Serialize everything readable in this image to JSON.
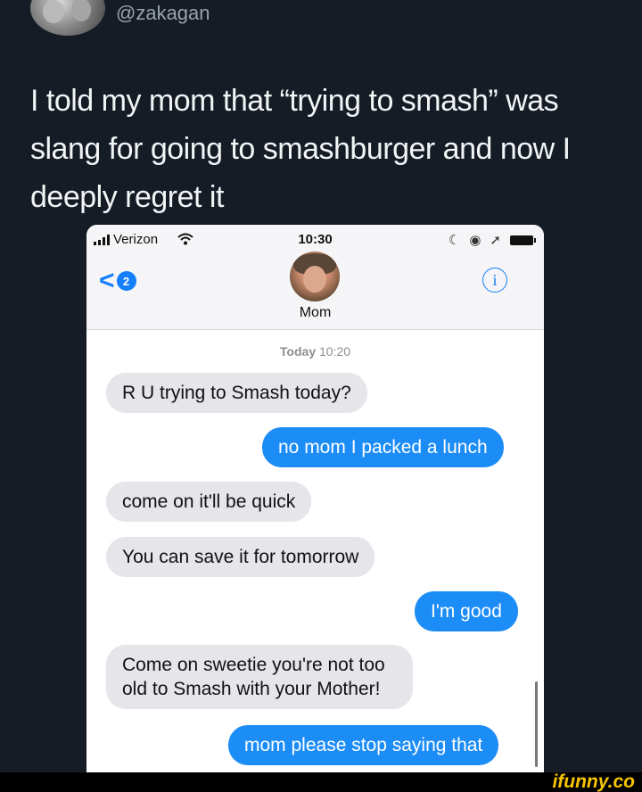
{
  "tweet": {
    "handle": "@zakagan",
    "text": "I told my mom that “trying to smash” was slang for going to smashburger and now I deeply regret it"
  },
  "phone": {
    "status_bar": {
      "carrier": "Verizon",
      "time": "10:30"
    },
    "header": {
      "back_count": "2",
      "contact_name": "Mom"
    },
    "timestamp": {
      "day": "Today",
      "time": "10:20"
    },
    "messages": [
      {
        "direction": "received",
        "text": "R U trying to Smash today?"
      },
      {
        "direction": "sent",
        "text": "no mom I packed a lunch"
      },
      {
        "direction": "received",
        "text": "come on it'll be quick"
      },
      {
        "direction": "received",
        "text": "You can save it for tomorrow"
      },
      {
        "direction": "sent",
        "text": "I'm good"
      },
      {
        "direction": "received",
        "text": "Come on sweetie you're not too old to Smash with your Mother!"
      },
      {
        "direction": "sent",
        "text": "mom please stop saying that"
      }
    ],
    "colors": {
      "sent_bubble": "#1c8cf6",
      "received_bubble": "#e5e5ea",
      "accent": "#147efb"
    }
  },
  "watermark": "ifunny.co"
}
